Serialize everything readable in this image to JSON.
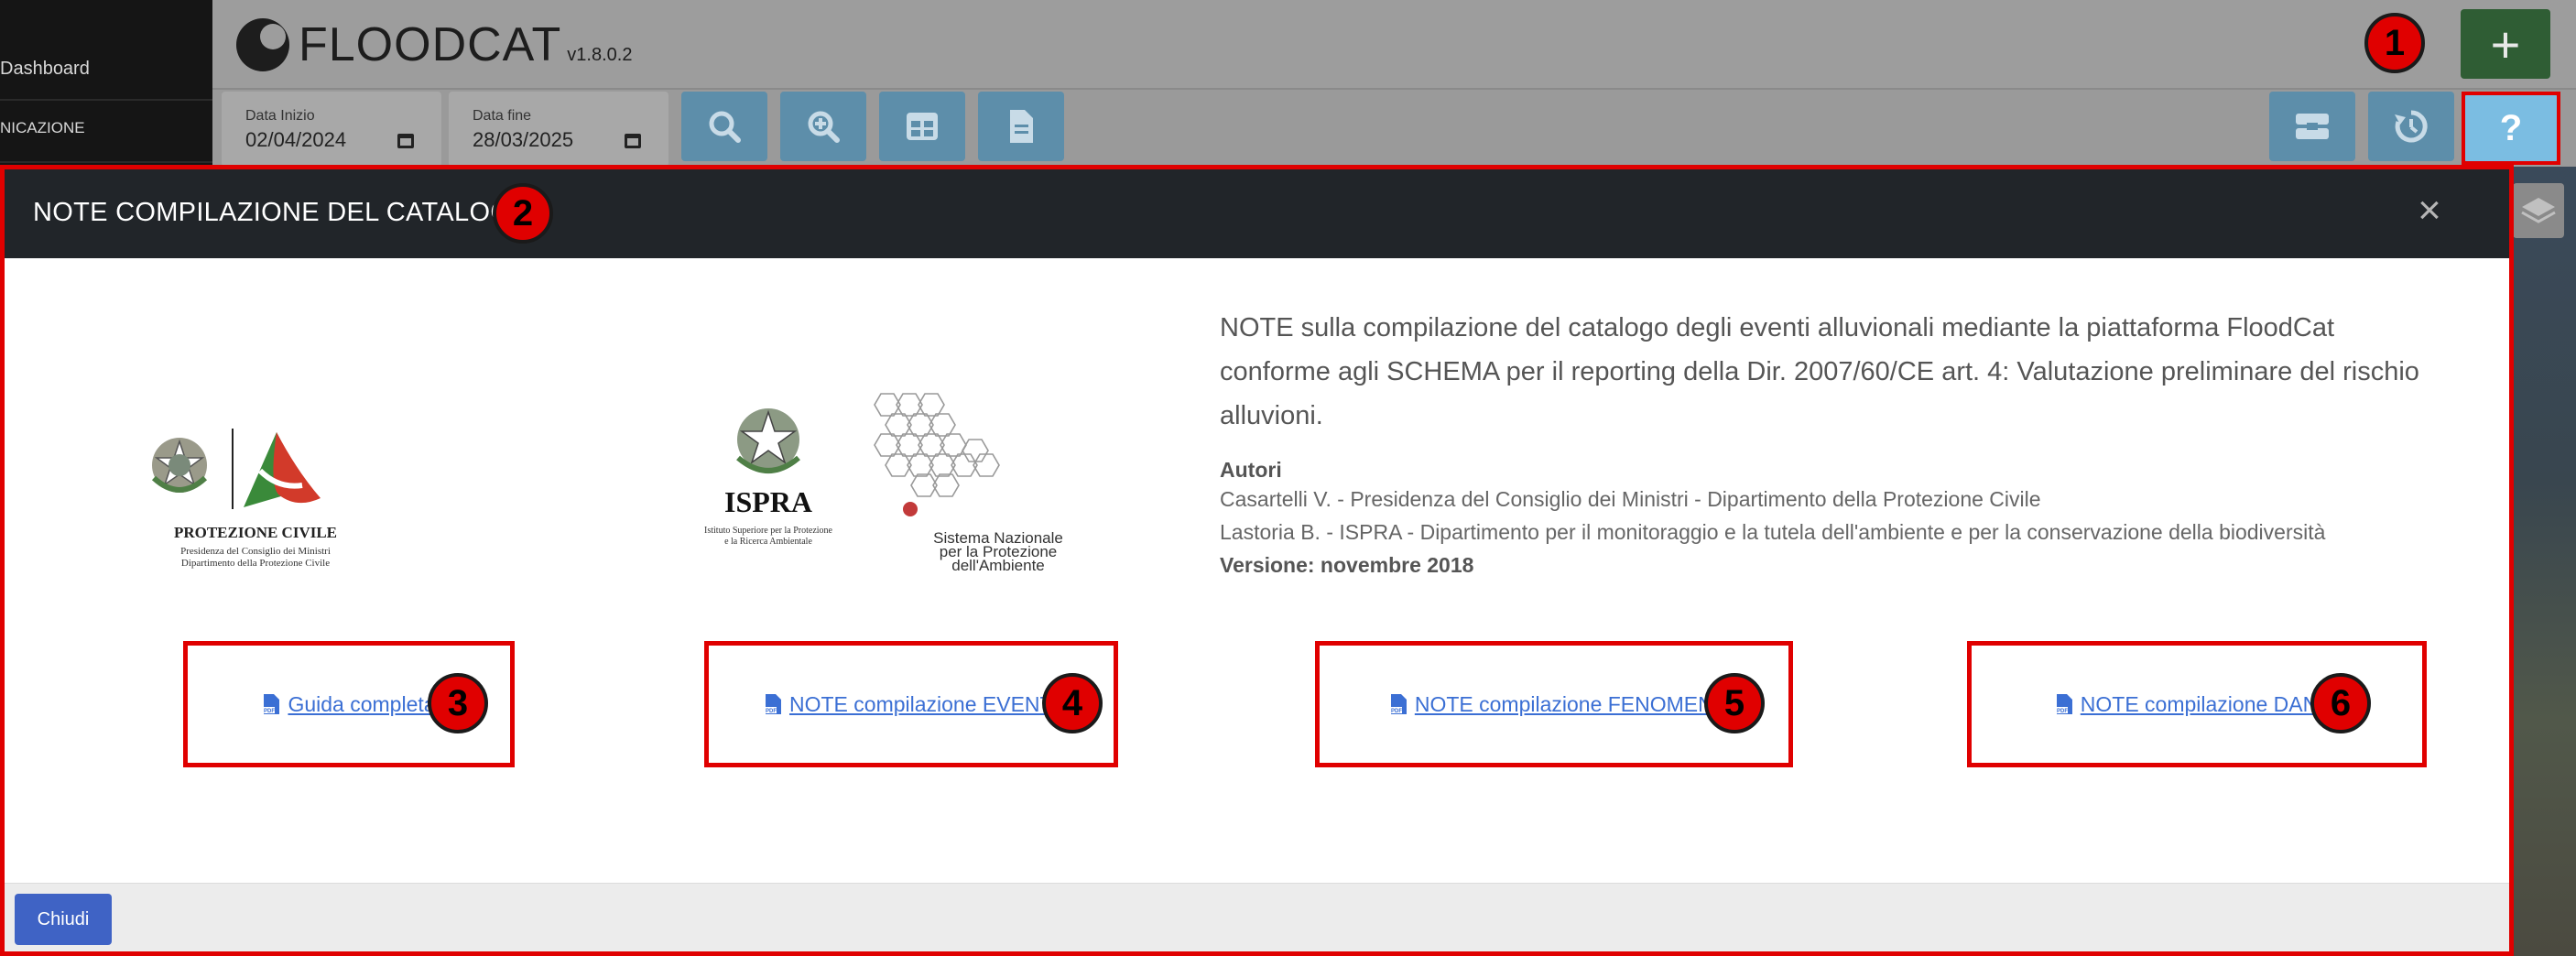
{
  "sidebar": {
    "items": [
      {
        "label": "Dashboard"
      },
      {
        "label": "NICAZIONE"
      }
    ]
  },
  "app": {
    "logo_text": "FLOODCAT",
    "version": "v1.8.0.2"
  },
  "toolbar": {
    "date_start": {
      "label": "Data Inizio",
      "value": "02/04/2024"
    },
    "date_end": {
      "label": "Data fine",
      "value": "28/03/2025"
    },
    "add_label": "+",
    "help_label": "?"
  },
  "annotations": [
    "1",
    "2",
    "3",
    "4",
    "5",
    "6"
  ],
  "modal": {
    "title": "NOTE COMPILAZIONE DEL CATALOGO",
    "close_label": "×",
    "description": "NOTE sulla compilazione del catalogo degli eventi alluvionali mediante la piattaforma FloodCat conforme agli SCHEMA per il reporting della Dir. 2007/60/CE art. 4: Valutazione preliminare del rischio alluvioni.",
    "authors_heading": "Autori",
    "authors": [
      "Casartelli V. - Presidenza del Consiglio dei Ministri - Dipartimento della Protezione Civile",
      "Lastoria B. - ISPRA - Dipartimento per il monitoraggio e la tutela dell'ambiente e per la conservazione della biodiversità"
    ],
    "version": "Versione: novembre 2018",
    "logos": {
      "protezione_civile": {
        "title": "PROTEZIONE CIVILE",
        "line1": "Presidenza del Consiglio dei Ministri",
        "line2": "Dipartimento della Protezione Civile"
      },
      "ispra": {
        "title": "ISPRA",
        "line1": "Istituto Superiore per la Protezione",
        "line2": "e la Ricerca Ambientale"
      },
      "snpa": {
        "line1": "Sistema Nazionale",
        "line2": "per la Protezione",
        "line3": "dell'Ambiente"
      }
    },
    "links": [
      {
        "label": "Guida completa"
      },
      {
        "label": "NOTE compilazione EVENTI"
      },
      {
        "label": "NOTE compilazione FENOMENI"
      },
      {
        "label": "NOTE compilazione DANNI"
      }
    ],
    "close_button": "Chiudi"
  },
  "colors": {
    "annotation_red": "#e00000",
    "link_blue": "#3b6fd4",
    "header_dark": "#212529",
    "primary_button": "#3f63c5"
  }
}
